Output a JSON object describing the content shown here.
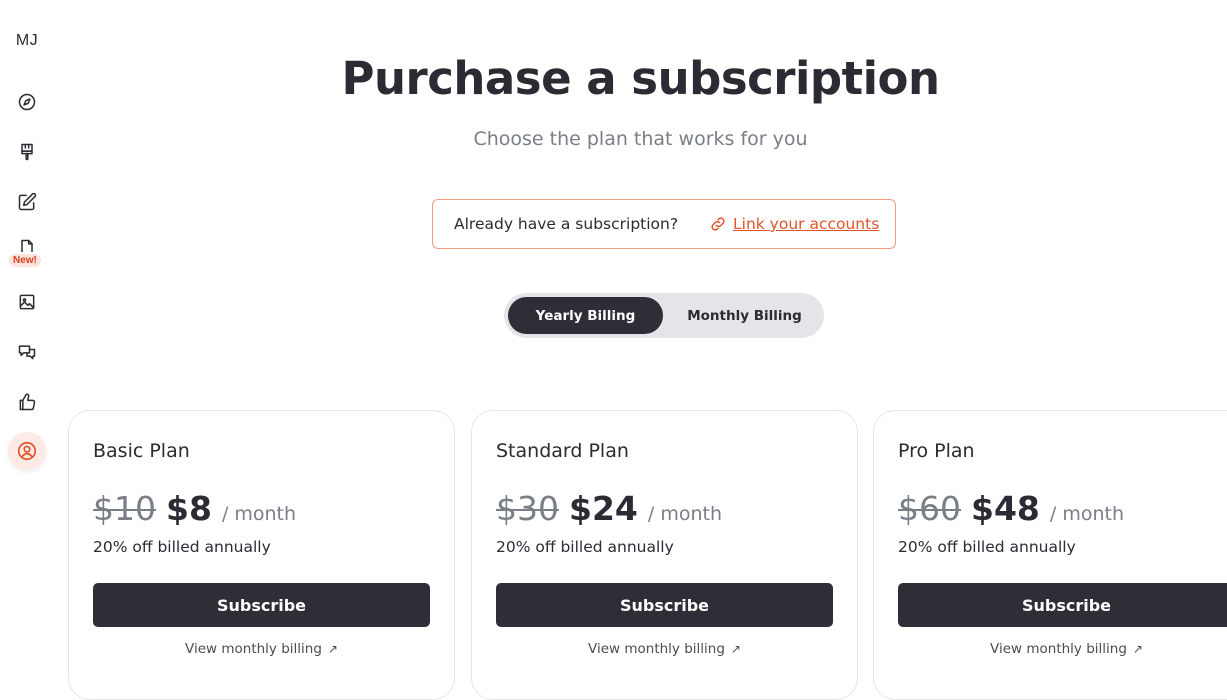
{
  "sidebar": {
    "initials": "MJ",
    "icons": [
      "compass-icon",
      "paint-brush-icon",
      "edit-icon",
      "document-icon",
      "image-icon",
      "chat-icon",
      "thumbs-up-icon",
      "account-icon"
    ],
    "new_badge": "New!"
  },
  "header": {
    "title": "Purchase a subscription",
    "subtitle": "Choose the plan that works for you"
  },
  "link_box": {
    "question": "Already have a subscription?",
    "link_label": "Link your accounts"
  },
  "billing_toggle": {
    "options": [
      "Yearly Billing",
      "Monthly Billing"
    ],
    "selected": "Yearly Billing"
  },
  "plans": [
    {
      "name": "Basic Plan",
      "old_price": "$10",
      "price": "$8",
      "period": "/ month",
      "discount": "20% off billed annually",
      "button": "Subscribe",
      "view_monthly": "View monthly billing"
    },
    {
      "name": "Standard Plan",
      "old_price": "$30",
      "price": "$24",
      "period": "/ month",
      "discount": "20% off billed annually",
      "button": "Subscribe",
      "view_monthly": "View monthly billing"
    },
    {
      "name": "Pro Plan",
      "old_price": "$60",
      "price": "$48",
      "period": "/ month",
      "discount": "20% off billed annually",
      "button": "Subscribe",
      "view_monthly": "View monthly billing"
    }
  ],
  "colors": {
    "accent": "#e2532c",
    "dark": "#2e2e36",
    "muted": "#7a7e86"
  }
}
